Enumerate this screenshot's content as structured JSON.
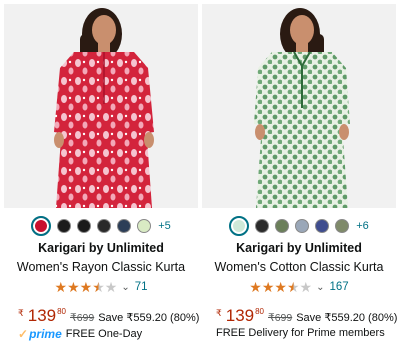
{
  "colors": {
    "link": "#007185",
    "price": "#b12704",
    "star": "#de7921",
    "prime": "#1a98ff"
  },
  "products": [
    {
      "swatches": [
        "#c8102e",
        "#1b1b1b",
        "#1a1a1a",
        "#2a2a2a",
        "#2c3e57",
        "#d9ebc4"
      ],
      "more": "+5",
      "brand": "Karigari by Unlimited",
      "title": "Women's Rayon Classic Kurta",
      "rating": 3.5,
      "reviews": "71",
      "currency": "₹",
      "price_whole": "139",
      "price_fraction": "80",
      "mrp": "₹699",
      "save": "Save ₹559.20 (80%)",
      "prime_label": "prime",
      "delivery": "FREE One-Day"
    },
    {
      "swatches": [
        "#cfe9d8",
        "#2b2b2b",
        "#6b7f5a",
        "#9aa7b8",
        "#3f4d8f",
        "#7f8a6a"
      ],
      "more": "+6",
      "brand": "Karigari by Unlimited",
      "title": "Women's Cotton Classic Kurta",
      "rating": 3.5,
      "reviews": "167",
      "currency": "₹",
      "price_whole": "139",
      "price_fraction": "80",
      "mrp": "₹699",
      "save": "Save ₹559.20 (80%)",
      "delivery": "FREE Delivery for Prime members"
    }
  ]
}
